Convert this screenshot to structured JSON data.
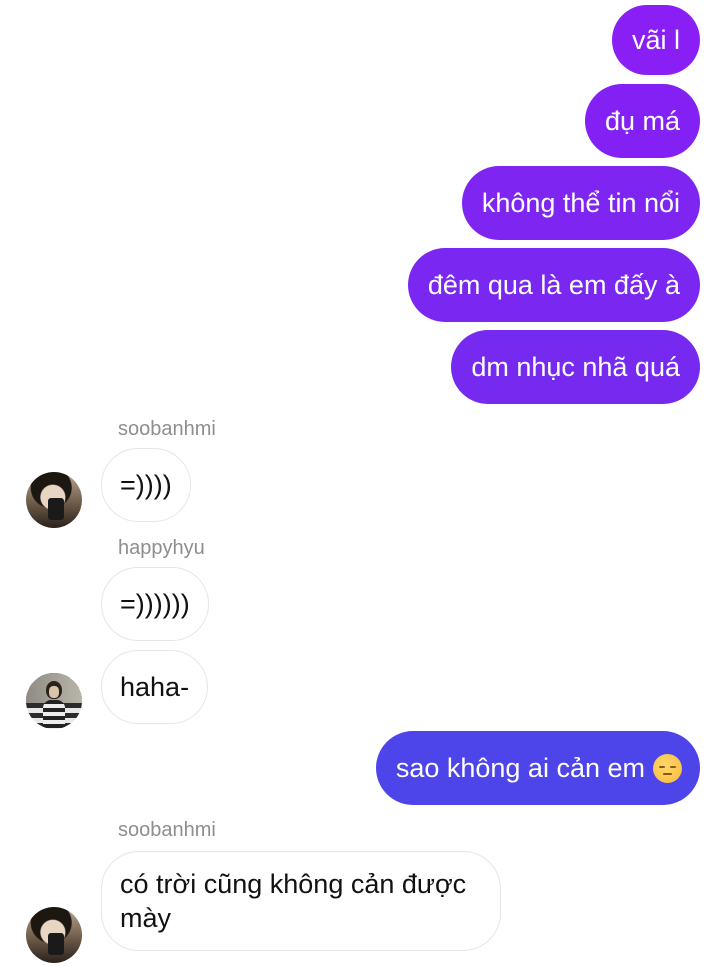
{
  "colors": {
    "outgoing_purple": "#8a21f5",
    "outgoing_violet": "#7a2ef0",
    "outgoing_blue": "#4b45e8",
    "incoming_border": "#e6e6e6",
    "sender_name": "#8e8e8e"
  },
  "messages": [
    {
      "direction": "outgoing",
      "text": "vãi l"
    },
    {
      "direction": "outgoing",
      "text": "đụ má"
    },
    {
      "direction": "outgoing",
      "text": "không thể tin nổi"
    },
    {
      "direction": "outgoing",
      "text": "đêm qua là em đấy à"
    },
    {
      "direction": "outgoing",
      "text": "dm nhục nhã quá"
    },
    {
      "direction": "incoming",
      "sender": "soobanhmi",
      "text": "=))))"
    },
    {
      "direction": "incoming",
      "sender": "happyhyu",
      "text": "=))))))"
    },
    {
      "direction": "incoming",
      "text": "haha-"
    },
    {
      "direction": "outgoing",
      "text": "sao không ai cản em",
      "emoji": "pensive-face-emoji"
    },
    {
      "direction": "incoming",
      "sender": "soobanhmi",
      "text": "có trời cũng không cản được mày"
    }
  ]
}
